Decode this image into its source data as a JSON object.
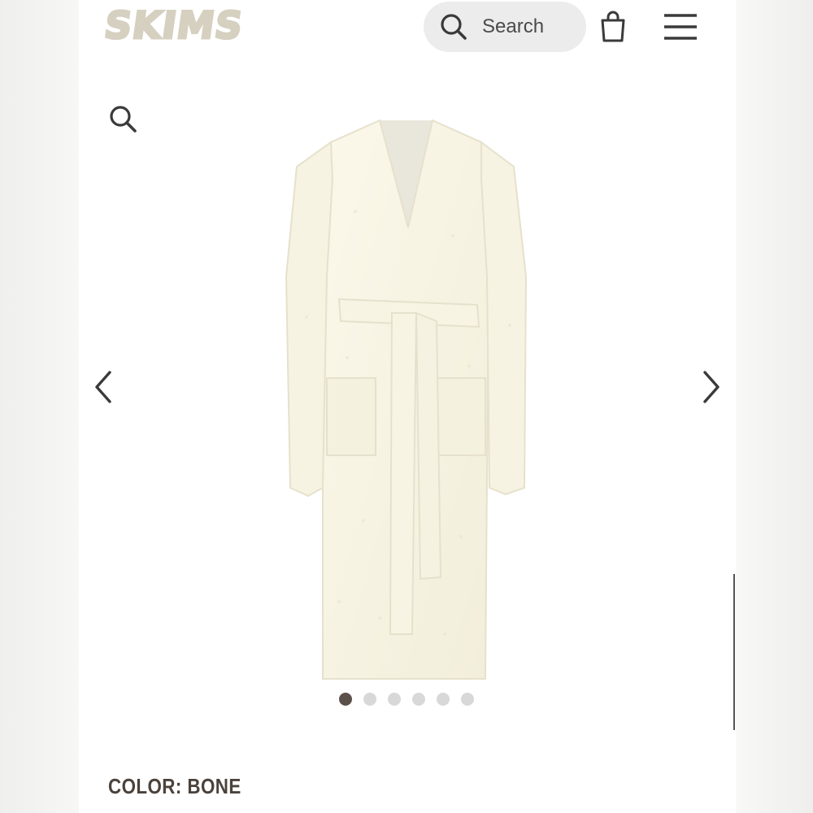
{
  "header": {
    "logo": "SKIMS",
    "search_placeholder": "Search"
  },
  "icons": {
    "search": "search-icon",
    "bag": "shopping-bag-icon",
    "menu": "hamburger-menu-icon",
    "zoom": "zoom-icon",
    "prev": "chevron-left-icon",
    "next": "chevron-right-icon"
  },
  "product": {
    "image_alt": "Bone long cozy knit robe with belt",
    "color_label": "COLOR: BONE"
  },
  "carousel": {
    "count": 6,
    "active_index": 0
  },
  "colors": {
    "logo": "#d6d0c0",
    "active_dot": "#5b514a",
    "inactive_dot": "#d8d8d8",
    "text": "#4b423b"
  }
}
